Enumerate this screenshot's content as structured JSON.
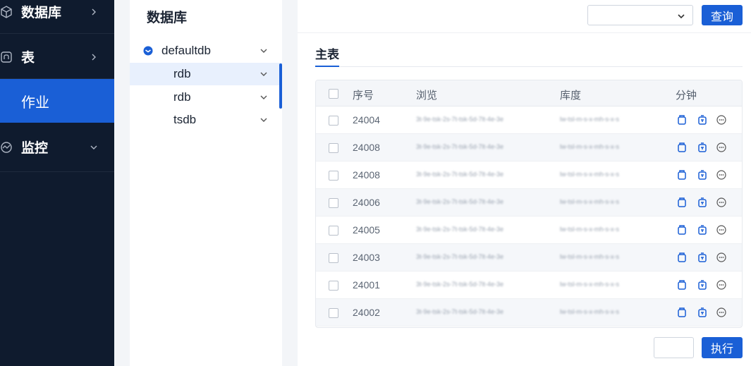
{
  "sidebar": {
    "items": [
      {
        "label": "数据库",
        "icon": "cube-icon",
        "chevron": "chevron-right-icon"
      },
      {
        "label": "表",
        "icon": "table-icon",
        "chevron": "chevron-right-icon"
      },
      {
        "label": "作业",
        "active": true
      },
      {
        "label": "监控",
        "icon": "monitor-icon",
        "chevron": "chevron-down-icon"
      }
    ]
  },
  "tree": {
    "title": "数据库",
    "nodes": [
      {
        "label": "defaultdb",
        "icon": "database-icon",
        "level": 0
      },
      {
        "label": "rdb",
        "level": 1,
        "selected": true
      },
      {
        "label": "rdb",
        "level": 1
      },
      {
        "label": "tsdb",
        "level": 1
      }
    ]
  },
  "toolbar": {
    "select_value": "",
    "query_label": "查询"
  },
  "section": {
    "title": "主表"
  },
  "table": {
    "columns": [
      "序号",
      "浏览",
      "库度",
      "分钟"
    ],
    "rows": [
      {
        "id": "24004",
        "c2": "3t-9e-tsk-2s-7t-tsk-5d-7lt-4e-3e",
        "c3": "lw-tsl-m-s-x-mh-s-x-s"
      },
      {
        "id": "24008",
        "c2": "3t-9e-tsk-2s-7t-tsk-5d-7lt-4e-3e",
        "c3": "lw-tsl-m-s-x-mh-s-x-s"
      },
      {
        "id": "24008",
        "c2": "3t-9e-tsk-2s-7t-tsk-5d-7lt-4e-3e",
        "c3": "lw-tsl-m-s-x-mh-s-x-s"
      },
      {
        "id": "24006",
        "c2": "3t-9e-tsk-2s-7t-tsk-5d-7lt-4e-3e",
        "c3": "lw-tsl-m-s-x-mh-s-x-s"
      },
      {
        "id": "24005",
        "c2": "3t-9e-tsk-2s-7t-tsk-5d-7lt-4e-3e",
        "c3": "lw-tsl-m-s-x-mh-s-x-s"
      },
      {
        "id": "24003",
        "c2": "3t-9e-tsk-2s-7t-tsk-5d-7lt-4e-3e",
        "c3": "lw-tsl-m-s-x-mh-s-x-s"
      },
      {
        "id": "24001",
        "c2": "3t-9e-tsk-2s-7t-tsk-5d-7lt-4e-3e",
        "c3": "lw-tsl-m-s-x-mh-s-x-s"
      },
      {
        "id": "24002",
        "c2": "3t-9e-tsk-2s-7t-tsk-5d-7lt-4e-3e",
        "c3": "lw-tsl-m-s-x-mh-s-x-s"
      }
    ],
    "row_actions": [
      "save-icon",
      "delete-icon",
      "more-icon"
    ]
  },
  "footer": {
    "page_input_value": "",
    "exec_label": "执行"
  },
  "colors": {
    "sidebar_bg": "#0f1b2e",
    "accent": "#1a5fd6",
    "selected_row": "#e8f0fd"
  }
}
